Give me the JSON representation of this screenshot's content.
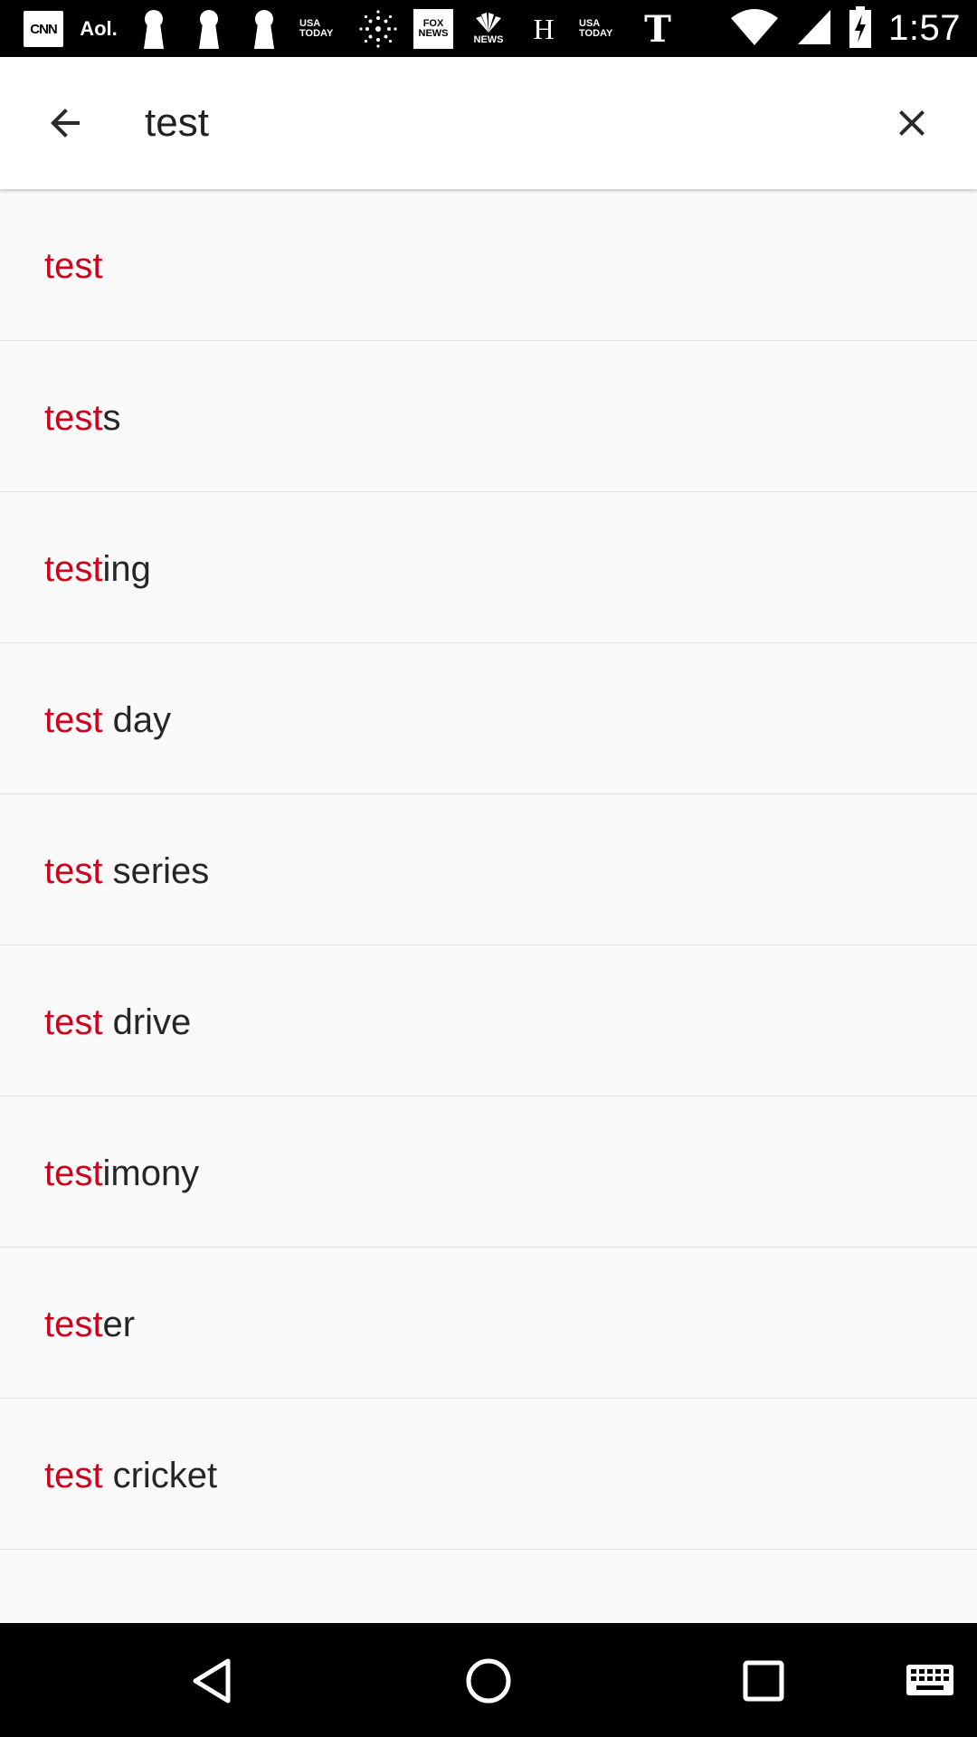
{
  "status_bar": {
    "time": "1:57",
    "notifications": [
      {
        "name": "cnn",
        "label": "CNN"
      },
      {
        "name": "aol",
        "label": "Aol."
      },
      {
        "name": "keyhole-1",
        "label": ""
      },
      {
        "name": "keyhole-2",
        "label": ""
      },
      {
        "name": "keyhole-3",
        "label": ""
      },
      {
        "name": "usa-today-1",
        "label": "USA TODAY"
      },
      {
        "name": "starburst",
        "label": ""
      },
      {
        "name": "fox-news",
        "label": "FOX NEWS"
      },
      {
        "name": "nbc-news",
        "label": "NEWS"
      },
      {
        "name": "history",
        "label": "H"
      },
      {
        "name": "usa-today-2",
        "label": "USA TODAY"
      },
      {
        "name": "nyt",
        "label": "T"
      }
    ],
    "icons": [
      "wifi-icon",
      "cell-signal-icon",
      "battery-charging-icon"
    ]
  },
  "search": {
    "query": "test",
    "placeholder": "",
    "back_icon": "arrow-back-icon",
    "clear_icon": "close-icon"
  },
  "suggestions": [
    {
      "match": "test",
      "rest": ""
    },
    {
      "match": "test",
      "rest": "s"
    },
    {
      "match": "test",
      "rest": "ing"
    },
    {
      "match": "test",
      "rest": " day"
    },
    {
      "match": "test",
      "rest": " series"
    },
    {
      "match": "test",
      "rest": " drive"
    },
    {
      "match": "test",
      "rest": "imony"
    },
    {
      "match": "test",
      "rest": "er"
    },
    {
      "match": "test",
      "rest": " cricket"
    },
    {
      "match": "",
      "rest": ""
    }
  ],
  "colors": {
    "match": "#d0021b",
    "text": "#212121",
    "divider": "#e3e3e3",
    "status_bar": "#000000",
    "nav_bar": "#000000"
  },
  "nav_bar": {
    "icons": [
      "back-triangle-icon",
      "home-circle-icon",
      "recents-square-icon",
      "keyboard-icon"
    ]
  }
}
